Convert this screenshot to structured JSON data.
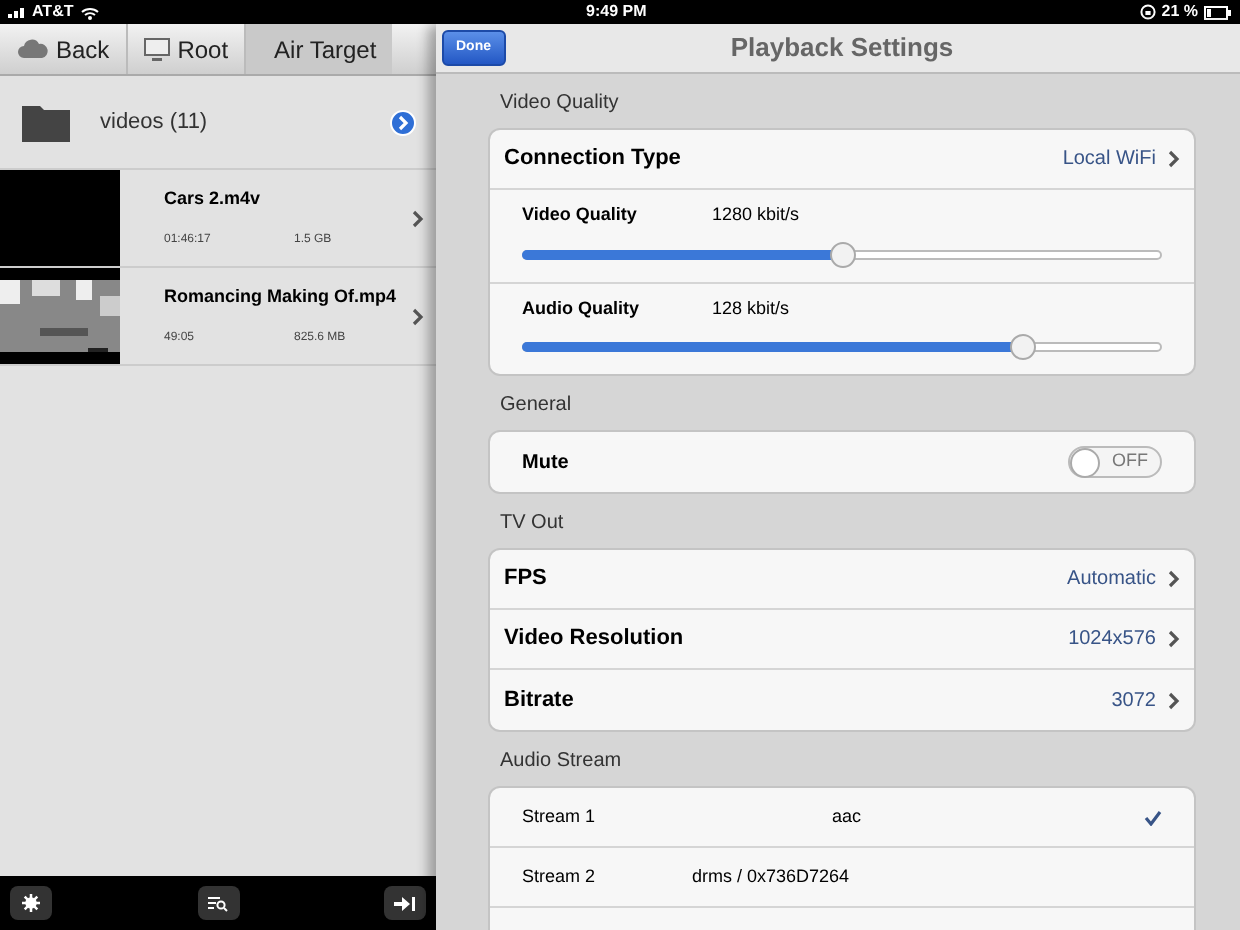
{
  "status_bar": {
    "carrier": "AT&T",
    "time": "9:49 PM",
    "battery": "21 %"
  },
  "browser": {
    "breadcrumbs": [
      {
        "label": "Back",
        "kind": "cloud"
      },
      {
        "label": "Root",
        "kind": "monitor"
      },
      {
        "label": "Air Target",
        "kind": "plain"
      }
    ],
    "folder": {
      "label": "videos (11)"
    },
    "videos": [
      {
        "name": "Cars 2.m4v",
        "duration": "01:46:17",
        "size": "1.5 GB",
        "kind": "blank"
      },
      {
        "name": "Romancing Making Of.mp4",
        "duration": "49:05",
        "size": "825.6 MB",
        "kind": "picture"
      }
    ]
  },
  "settings": {
    "title": "Playback Settings",
    "done": "Done",
    "sections": [
      {
        "header": "Video Quality",
        "rows": [
          {
            "kind": "link",
            "label": "Connection Type",
            "value": "Local WiFi"
          },
          {
            "kind": "slider",
            "label": "Video Quality",
            "value": "1280 kbit/s",
            "level": 0.5
          },
          {
            "kind": "slider",
            "label": "Audio Quality",
            "value": "128 kbit/s",
            "level": 0.78
          }
        ]
      },
      {
        "header": "General",
        "rows": [
          {
            "kind": "switch",
            "label": "Mute",
            "value": "OFF",
            "on": false
          }
        ]
      },
      {
        "header": "TV Out",
        "rows": [
          {
            "kind": "link",
            "label": "FPS",
            "value": "Automatic"
          },
          {
            "kind": "link",
            "label": "Video Resolution",
            "value": "1024x576"
          },
          {
            "kind": "link",
            "label": "Bitrate",
            "value": "3072"
          }
        ]
      },
      {
        "header": "Audio Stream",
        "rows": [
          {
            "kind": "stream",
            "label": "Stream 1",
            "value": "aac",
            "selected": true
          },
          {
            "kind": "stream",
            "label": "Stream 2",
            "value": "drms / 0x736D7264",
            "selected": false
          },
          {
            "kind": "empty"
          }
        ]
      }
    ]
  }
}
